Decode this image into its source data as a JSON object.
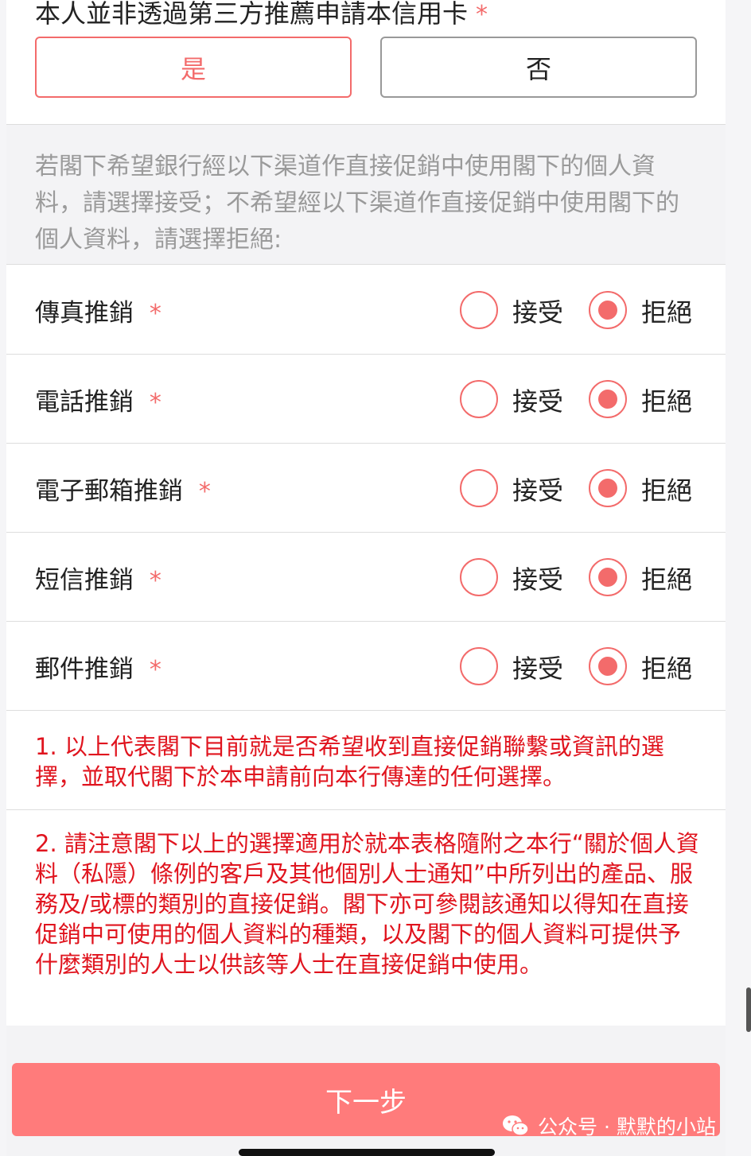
{
  "question": {
    "title": "本人並非透過第三方推薦申請本信用卡",
    "required_mark": "*",
    "yes_label": "是",
    "no_label": "否"
  },
  "notice": {
    "text": "若閣下希望銀行經以下渠道作直接促銷中使用閣下的個人資料，請選擇接受；不希望經以下渠道作直接促銷中使用閣下的個人資料，請選擇拒絕:"
  },
  "channels": [
    {
      "label": "傳真推銷",
      "required_mark": "*",
      "accept_label": "接受",
      "reject_label": "拒絕",
      "selected": "reject"
    },
    {
      "label": "電話推銷",
      "required_mark": "*",
      "accept_label": "接受",
      "reject_label": "拒絕",
      "selected": "reject"
    },
    {
      "label": "電子郵箱推銷",
      "required_mark": "*",
      "accept_label": "接受",
      "reject_label": "拒絕",
      "selected": "reject"
    },
    {
      "label": "短信推銷",
      "required_mark": "*",
      "accept_label": "接受",
      "reject_label": "拒絕",
      "selected": "reject"
    },
    {
      "label": "郵件推銷",
      "required_mark": "*",
      "accept_label": "接受",
      "reject_label": "拒絕",
      "selected": "reject"
    }
  ],
  "notes": [
    "1. 以上代表閣下目前就是否希望收到直接促銷聯繫或資訊的選擇，並取代閣下於本申請前向本行傳達的任何選擇。",
    "2. 請注意閣下以上的選擇適用於就本表格隨附之本行“關於個人資料（私隱）條例的客戶及其他個別人士通知”中所列出的產品、服務及/或標的類別的直接促銷。閣下亦可參閱該通知以得知在直接促銷中可使用的個人資料的種類，以及閣下的個人資料可提供予什麼類別的人士以供該等人士在直接促銷中使用。"
  ],
  "next_button": "下一步",
  "watermark": "公众号 · 默默的小站",
  "colors": {
    "accent": "#f36b6b",
    "button": "#ff7b7b",
    "note_red": "#e0141e"
  }
}
